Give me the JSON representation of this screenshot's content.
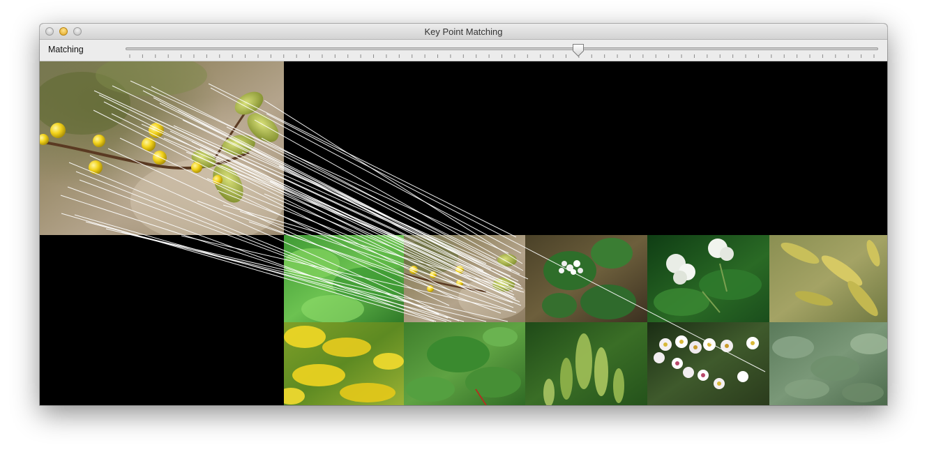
{
  "window": {
    "title": "Key Point Matching"
  },
  "toolbar": {
    "label": "Matching",
    "slider": {
      "value_fraction": 0.6015,
      "tick_count": 59
    }
  },
  "matching_view": {
    "query_image": "yellow-berries-branch",
    "database_images": [
      [
        "bright-green-leafy-plant",
        "yellow-berries-branch",
        "white-flower-cluster-leaves",
        "white-flower-umbels",
        "yellow-seed-spikes"
      ],
      [
        "goldenrod-yellow-flowers",
        "green-lobed-leaves",
        "green-spiky-seed-heads",
        "white-daisies",
        "blue-green-palmate-leaves"
      ]
    ],
    "match_line_color": "#ffffff"
  },
  "colors": {
    "canvas_bg": "#000000",
    "toolbar_bg": "#ececec",
    "minimize_button": "#e8b23a"
  }
}
